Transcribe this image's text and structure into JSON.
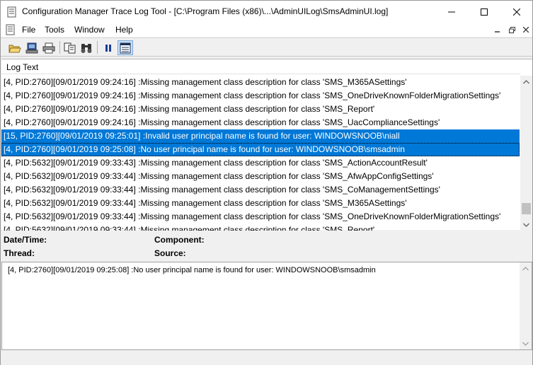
{
  "window": {
    "title": "Configuration Manager Trace Log Tool - [C:\\Program Files (x86)\\...\\AdminUILog\\SmsAdminUI.log]"
  },
  "menu": {
    "items": [
      "File",
      "Tools",
      "Window",
      "Help"
    ]
  },
  "toolbar": {
    "buttons": [
      "open-folder-icon",
      "open-remote-icon",
      "print-icon",
      "copy-icon",
      "find-icon",
      "pause-icon",
      "error-lookup-icon"
    ]
  },
  "log": {
    "column_header": "Log Text",
    "rows": [
      {
        "text": "[4, PID:2760][09/01/2019 09:24:16] :Missing management class description for class 'SMS_M365ASettings'",
        "state": "normal"
      },
      {
        "text": "[4, PID:2760][09/01/2019 09:24:16] :Missing management class description for class 'SMS_OneDriveKnownFolderMigrationSettings'",
        "state": "normal"
      },
      {
        "text": "[4, PID:2760][09/01/2019 09:24:16] :Missing management class description for class 'SMS_Report'",
        "state": "normal"
      },
      {
        "text": "[4, PID:2760][09/01/2019 09:24:16] :Missing management class description for class 'SMS_UacComplianceSettings'",
        "state": "normal"
      },
      {
        "text": "[15, PID:2760][09/01/2019 09:25:01] :Invalid user principal name is found for user: WINDOWSNOOB\\niall",
        "state": "selected"
      },
      {
        "text": "[4, PID:2760][09/01/2019 09:25:08] :No user principal name is found for user: WINDOWSNOOB\\smsadmin",
        "state": "focused"
      },
      {
        "text": "[4, PID:5632][09/01/2019 09:33:43] :Missing management class description for class 'SMS_ActionAccountResult'",
        "state": "normal"
      },
      {
        "text": "[4, PID:5632][09/01/2019 09:33:44] :Missing management class description for class 'SMS_AfwAppConfigSettings'",
        "state": "normal"
      },
      {
        "text": "[4, PID:5632][09/01/2019 09:33:44] :Missing management class description for class 'SMS_CoManagementSettings'",
        "state": "normal"
      },
      {
        "text": "[4, PID:5632][09/01/2019 09:33:44] :Missing management class description for class 'SMS_M365ASettings'",
        "state": "normal"
      },
      {
        "text": "[4, PID:5632][09/01/2019 09:33:44] :Missing management class description for class 'SMS_OneDriveKnownFolderMigrationSettings'",
        "state": "normal"
      },
      {
        "text": "[4, PID:5632][09/01/2019 09:33:44] :Missing management class description for class 'SMS_Report'",
        "state": "normal"
      }
    ]
  },
  "details": {
    "datetime_label": "Date/Time:",
    "component_label": "Component:",
    "thread_label": "Thread:",
    "source_label": "Source:",
    "message": "[4, PID:2760][09/01/2019 09:25:08] :No user principal name is found for user: WINDOWSNOOB\\smsadmin"
  },
  "colors": {
    "selection": "#0078d7"
  }
}
